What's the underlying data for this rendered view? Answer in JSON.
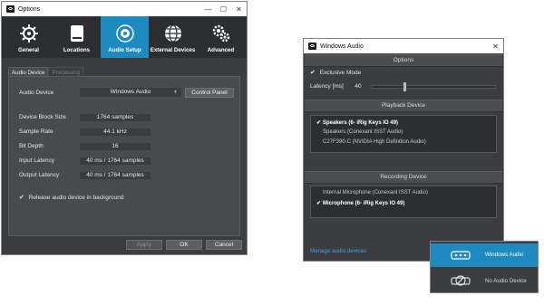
{
  "options": {
    "title": "Options",
    "window_buttons": [
      "—",
      "☐",
      "✕"
    ],
    "toolbar": [
      {
        "label": "General",
        "icon": "gear-sun-icon"
      },
      {
        "label": "Locations",
        "icon": "drive-icon"
      },
      {
        "label": "Audio Setup",
        "icon": "speaker-icon",
        "active": true
      },
      {
        "label": "External Devices",
        "icon": "globe-icon"
      },
      {
        "label": "Advanced",
        "icon": "gears-icon"
      }
    ],
    "tabs": [
      "Audio Device",
      "Processing"
    ],
    "audio_device_label": "Audio Device",
    "audio_device_value": "Windows Audio",
    "control_panel": "Control Panel",
    "rows": [
      {
        "label": "Device Block Size",
        "value": "1764 samples"
      },
      {
        "label": "Sample Rate",
        "value": "44.1 kHz"
      },
      {
        "label": "Bit Depth",
        "value": "16"
      },
      {
        "label": "Input Latency",
        "value": "40 ms / 1764 samples"
      },
      {
        "label": "Output Latency",
        "value": "40 ms / 1764 samples"
      }
    ],
    "release_label": "Release audio device in background",
    "apply": "Apply",
    "ok": "OK",
    "cancel": "Cancel"
  },
  "windows_audio": {
    "title": "Windows Audio",
    "close": "✕",
    "options_header": "Options",
    "exclusive_mode": "Exclusive Mode",
    "latency_label": "Latency [ms]",
    "latency_value": "40",
    "playback_header": "Playback Device",
    "playback_devices": [
      {
        "name": "Speakers (6- iRig Keys IO 49)",
        "selected": true
      },
      {
        "name": "Speakers (Conexant ISST Audio)",
        "selected": false
      },
      {
        "name": "C27F390-C (NVIDIA High Definition Audio)",
        "selected": false
      }
    ],
    "recording_header": "Recording Device",
    "recording_devices": [
      {
        "name": "Internal Microphone (Conexant ISST Audio)",
        "selected": false
      },
      {
        "name": "Microphone (6- iRig Keys IO 49)",
        "selected": true
      }
    ],
    "manage_link": "Manage audio devices"
  },
  "device_popup": {
    "items": [
      {
        "label": "Windows Audio",
        "icon": "audio-interface-icon",
        "active": true
      },
      {
        "label": "No Audio Device",
        "icon": "no-device-icon",
        "active": false
      }
    ]
  },
  "colors": {
    "accent": "#1d8ac0",
    "panel": "#3b3d40",
    "link": "#3fa1dd"
  }
}
